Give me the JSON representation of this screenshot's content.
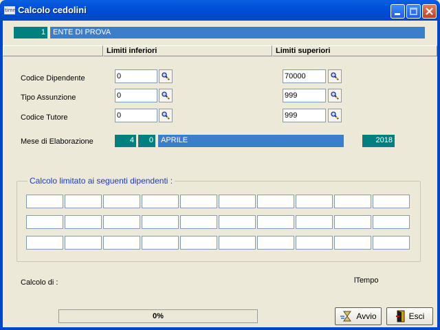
{
  "window": {
    "title": "Calcolo cedolini",
    "app_icon_text": "timn"
  },
  "company": {
    "code": "1",
    "name": "ENTE DI PROVA"
  },
  "headers": {
    "lower": "Limiti inferiori",
    "upper": "Limiti superiori"
  },
  "fields": [
    {
      "label": "Codice Dipendente",
      "lower": "0",
      "upper": "70000"
    },
    {
      "label": "Tipo Assunzione",
      "lower": "0",
      "upper": "999"
    },
    {
      "label": "Codice Tutore",
      "lower": "0",
      "upper": "999"
    }
  ],
  "period": {
    "label": "Mese di Elaborazione",
    "month_num": "4",
    "day": "0",
    "month_name": "APRILE",
    "year": "2018"
  },
  "employees_group": {
    "title": "Calcolo limitato ai seguenti dipendenti :",
    "rows": 3,
    "cols": 10
  },
  "status": {
    "calc_label": "Calcolo di :",
    "time_label": "lTempo",
    "progress_text": "0%",
    "progress": 0
  },
  "buttons": {
    "start": "Avvio",
    "exit": "Esci"
  },
  "icons": {
    "lookup": "search-lookup-icon",
    "start": "hourglass-run-icon",
    "exit": "door-exit-icon"
  }
}
